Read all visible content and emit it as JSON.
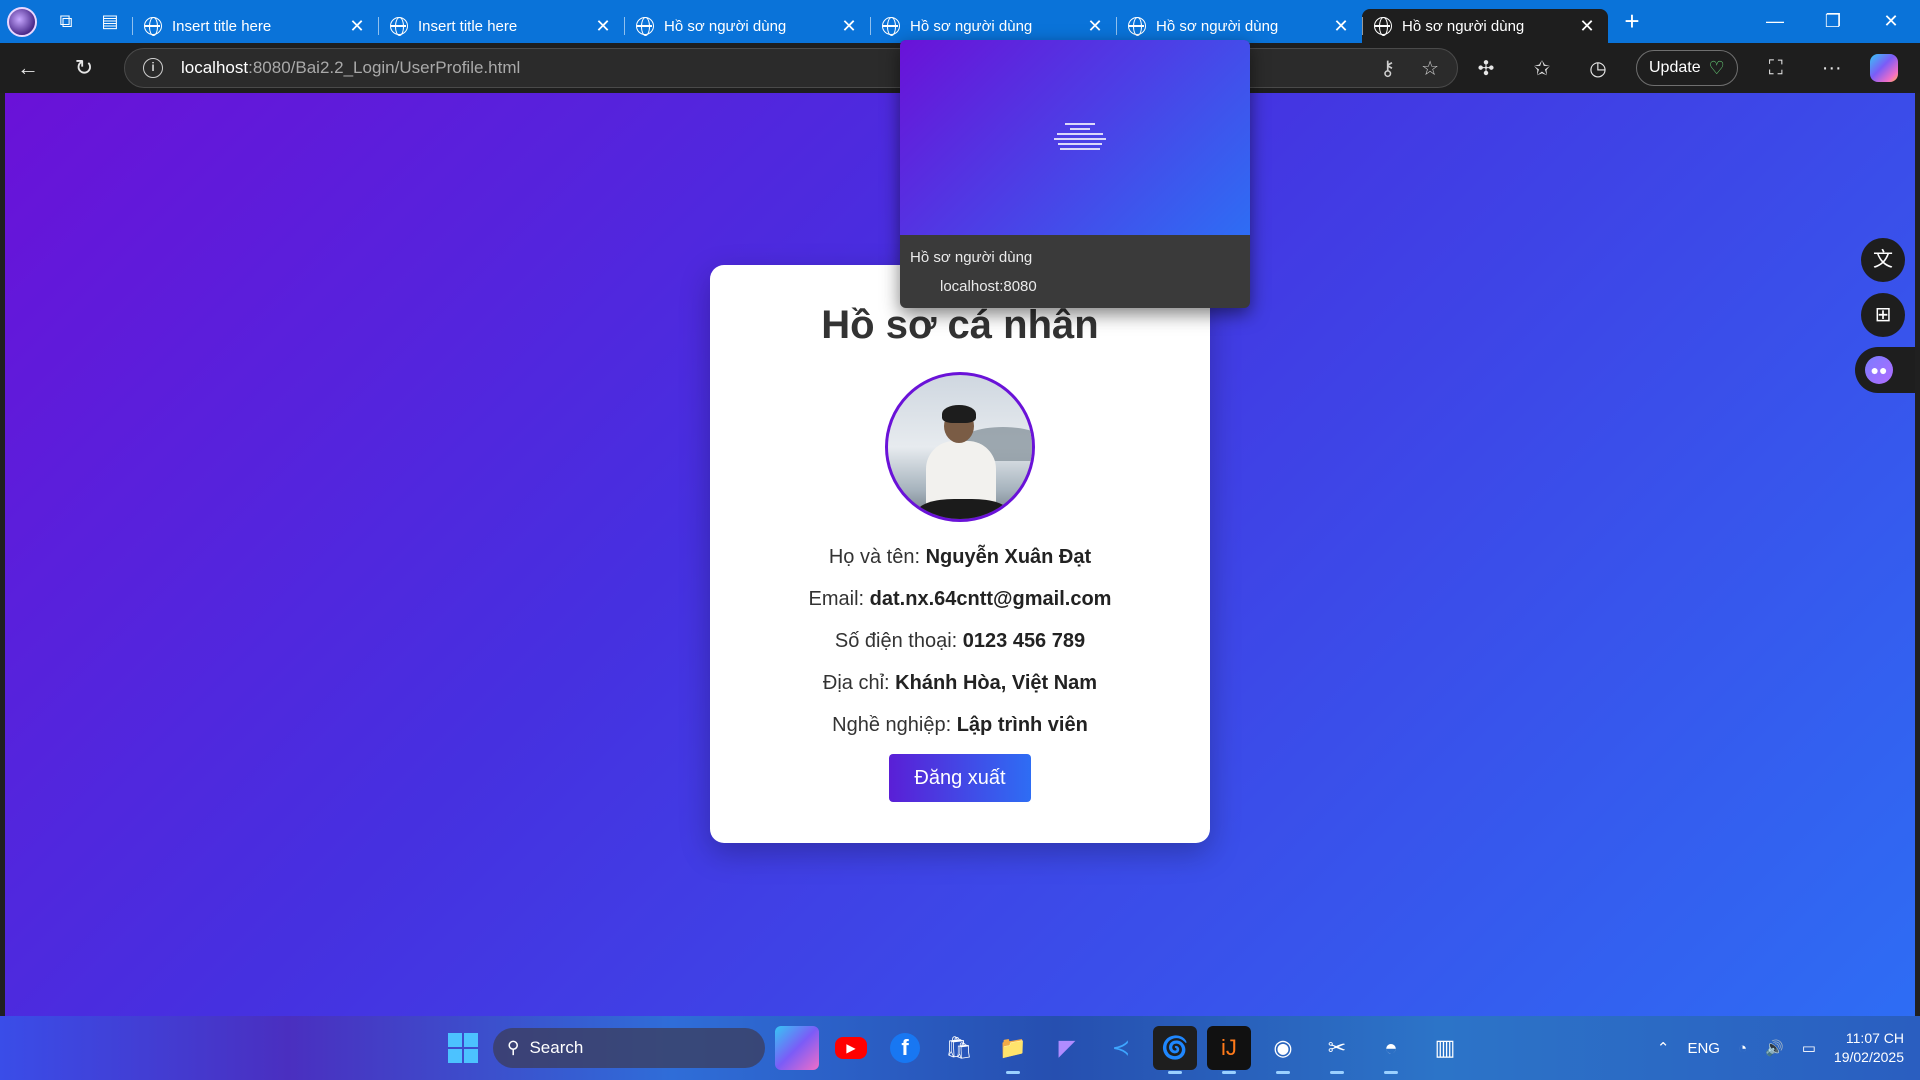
{
  "browser": {
    "tabs": [
      {
        "title": "Insert title here"
      },
      {
        "title": "Insert title here"
      },
      {
        "title": "Hồ sơ người dùng"
      },
      {
        "title": "Hồ sơ người dùng"
      },
      {
        "title": "Hồ sơ người dùng"
      },
      {
        "title": "Hồ sơ người dùng",
        "active": true
      }
    ],
    "url_host": "localhost",
    "url_path": ":8080/Bai2.2_Login/UserProfile.html",
    "update_label": "Update"
  },
  "preview": {
    "title": "Hồ sơ người dùng",
    "host": "localhost:8080"
  },
  "profile": {
    "heading": "Hồ sơ cá nhân",
    "fields": [
      {
        "label": "Họ và tên:",
        "value": "Nguyễn Xuân Đạt"
      },
      {
        "label": "Email:",
        "value": "dat.nx.64cntt@gmail.com"
      },
      {
        "label": "Số điện thoại:",
        "value": "0123 456 789"
      },
      {
        "label": "Địa chỉ:",
        "value": "Khánh Hòa, Việt Nam"
      },
      {
        "label": "Nghề nghiệp:",
        "value": "Lập trình viên"
      }
    ],
    "logout_label": "Đăng xuất"
  },
  "taskbar": {
    "search_label": "Search",
    "language": "ENG",
    "time": "11:07 CH",
    "date": "19/02/2025"
  },
  "colors": {
    "gradient_start": "#6a12d8",
    "gradient_end": "#2e6df4",
    "tabstrip": "#0a73d9"
  }
}
